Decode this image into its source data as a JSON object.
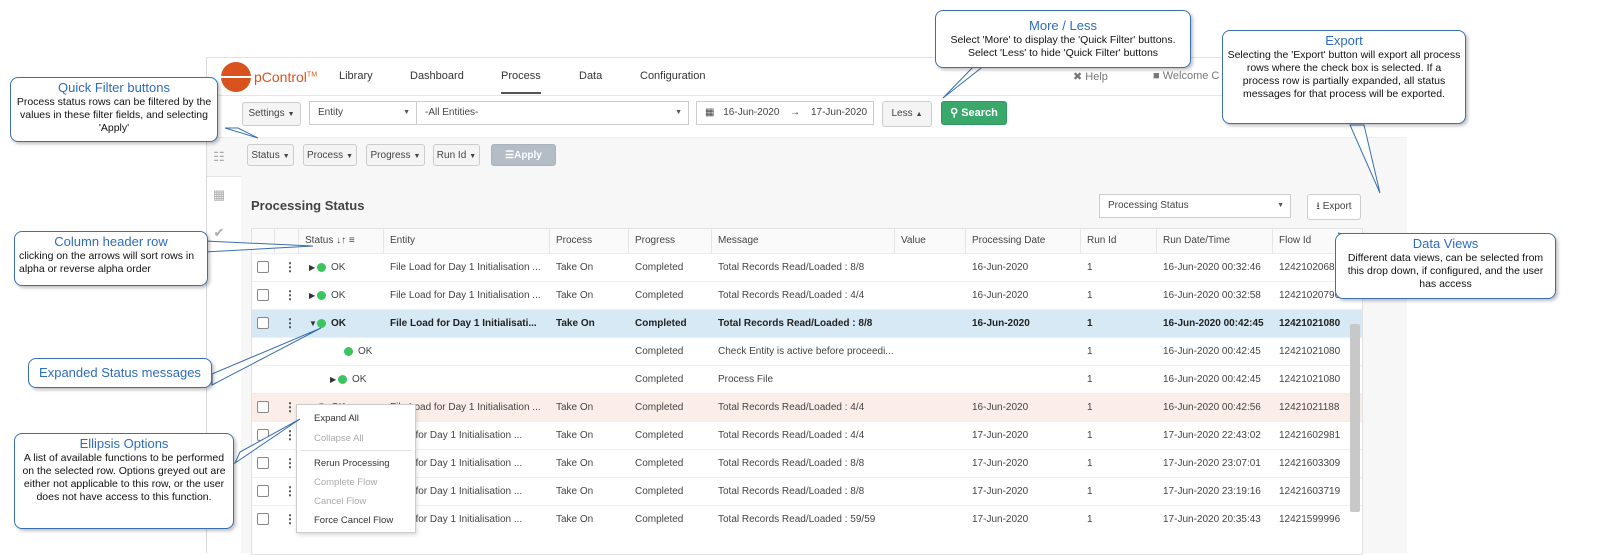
{
  "nav": {
    "logo": "pControl",
    "tabs": [
      "Library",
      "Dashboard",
      "Process",
      "Data",
      "Configuration"
    ],
    "active_tab": "Process",
    "help": "Help",
    "welcome": "Welcome C"
  },
  "filters": {
    "settings": "Settings",
    "entity": "Entity",
    "entity_value": "-All Entities-",
    "date_from": "16-Jun-2020",
    "date_to": "17-Jun-2020",
    "less": "Less",
    "search": "Search"
  },
  "quick": {
    "status": "Status",
    "process": "Process",
    "progress": "Progress",
    "runid": "Run Id",
    "apply": "Apply"
  },
  "section": {
    "title": "Processing Status",
    "view": "Processing Status",
    "export": "Export"
  },
  "columns": [
    "Status",
    "Entity",
    "Process",
    "Progress",
    "Message",
    "Value",
    "Processing Date",
    "Run Id",
    "Run Date/Time",
    "Flow Id"
  ],
  "rows": [
    {
      "status": "OK",
      "entity": "File Load for Day 1 Initialisation ...",
      "process": "Take On",
      "progress": "Completed",
      "message": "Total Records Read/Loaded : 8/8",
      "date": "16-Jun-2020",
      "runid": "1",
      "rundt": "16-Jun-2020 00:32:46",
      "flow": "12421020688"
    },
    {
      "status": "OK",
      "entity": "File Load for Day 1 Initialisation ...",
      "process": "Take On",
      "progress": "Completed",
      "message": "Total Records Read/Loaded : 4/4",
      "date": "16-Jun-2020",
      "runid": "1",
      "rundt": "16-Jun-2020 00:32:58",
      "flow": "12421020796"
    },
    {
      "status": "OK",
      "entity": "File Load for Day 1 Initialisati...",
      "process": "Take On",
      "progress": "Completed",
      "message": "Total Records Read/Loaded : 8/8",
      "date": "16-Jun-2020",
      "runid": "1",
      "rundt": "16-Jun-2020 00:42:45",
      "flow": "12421021080"
    },
    {
      "status": "OK",
      "entity": "",
      "process": "",
      "progress": "Completed",
      "message": "Check Entity is active before proceedi...",
      "date": "",
      "runid": "1",
      "rundt": "16-Jun-2020 00:42:45",
      "flow": "12421021080"
    },
    {
      "status": "OK",
      "entity": "",
      "process": "",
      "progress": "Completed",
      "message": "Process File",
      "date": "",
      "runid": "1",
      "rundt": "16-Jun-2020 00:42:45",
      "flow": "12421021080"
    },
    {
      "status": "OK",
      "entity": "File Load for Day 1 Initialisation ...",
      "process": "Take On",
      "progress": "Completed",
      "message": "Total Records Read/Loaded : 4/4",
      "date": "16-Jun-2020",
      "runid": "1",
      "rundt": "16-Jun-2020 00:42:56",
      "flow": "12421021188"
    },
    {
      "status": "OK",
      "entity": "oad for Day 1 Initialisation ...",
      "process": "Take On",
      "progress": "Completed",
      "message": "Total Records Read/Loaded : 4/4",
      "date": "17-Jun-2020",
      "runid": "1",
      "rundt": "17-Jun-2020 22:43:02",
      "flow": "12421602981"
    },
    {
      "status": "OK",
      "entity": "oad for Day 1 Initialisation ...",
      "process": "Take On",
      "progress": "Completed",
      "message": "Total Records Read/Loaded : 8/8",
      "date": "17-Jun-2020",
      "runid": "1",
      "rundt": "17-Jun-2020 23:07:01",
      "flow": "12421603309"
    },
    {
      "status": "OK",
      "entity": "oad for Day 1 Initialisation ...",
      "process": "Take On",
      "progress": "Completed",
      "message": "Total Records Read/Loaded : 8/8",
      "date": "17-Jun-2020",
      "runid": "1",
      "rundt": "17-Jun-2020 23:19:16",
      "flow": "12421603719"
    },
    {
      "status": "OK",
      "entity": "oad for Day 1 Initialisation ...",
      "process": "Take On",
      "progress": "Completed",
      "message": "Total Records Read/Loaded : 59/59",
      "date": "17-Jun-2020",
      "runid": "1",
      "rundt": "17-Jun-2020 20:35:43",
      "flow": "12421599996"
    }
  ],
  "menu": {
    "expand_all": "Expand All",
    "collapse_all": "Collapse All",
    "rerun": "Rerun Processing",
    "complete_flow": "Complete Flow",
    "cancel_flow": "Cancel Flow",
    "force_cancel": "Force Cancel Flow"
  },
  "callouts": {
    "quick_title": "Quick Filter buttons",
    "quick_desc": "Process status rows can be filtered by the values in these filter fields, and selecting 'Apply'",
    "more_title": "More / Less",
    "more_desc1": "Select 'More' to display the 'Quick Filter' buttons.",
    "more_desc2": "Select 'Less' to hide 'Quick Filter' buttons",
    "export_title": "Export",
    "export_desc": "Selecting the 'Export' button will export all process rows where the check box is selected. If a process row is partially expanded, all status messages for that process will be exported.",
    "column_title": "Column header row",
    "column_desc": "clicking on the arrows will sort rows in alpha or reverse alpha order",
    "views_title": "Data Views",
    "views_desc": "Different data views, can be selected from this drop down, if configured, and the user has access",
    "expanded_title": "Expanded Status messages",
    "ellipsis_title": "Ellipsis Options",
    "ellipsis_desc": "A list of available functions to be performed on the selected row. Options greyed out are either not applicable to this row, or the user does not have access to this function."
  }
}
